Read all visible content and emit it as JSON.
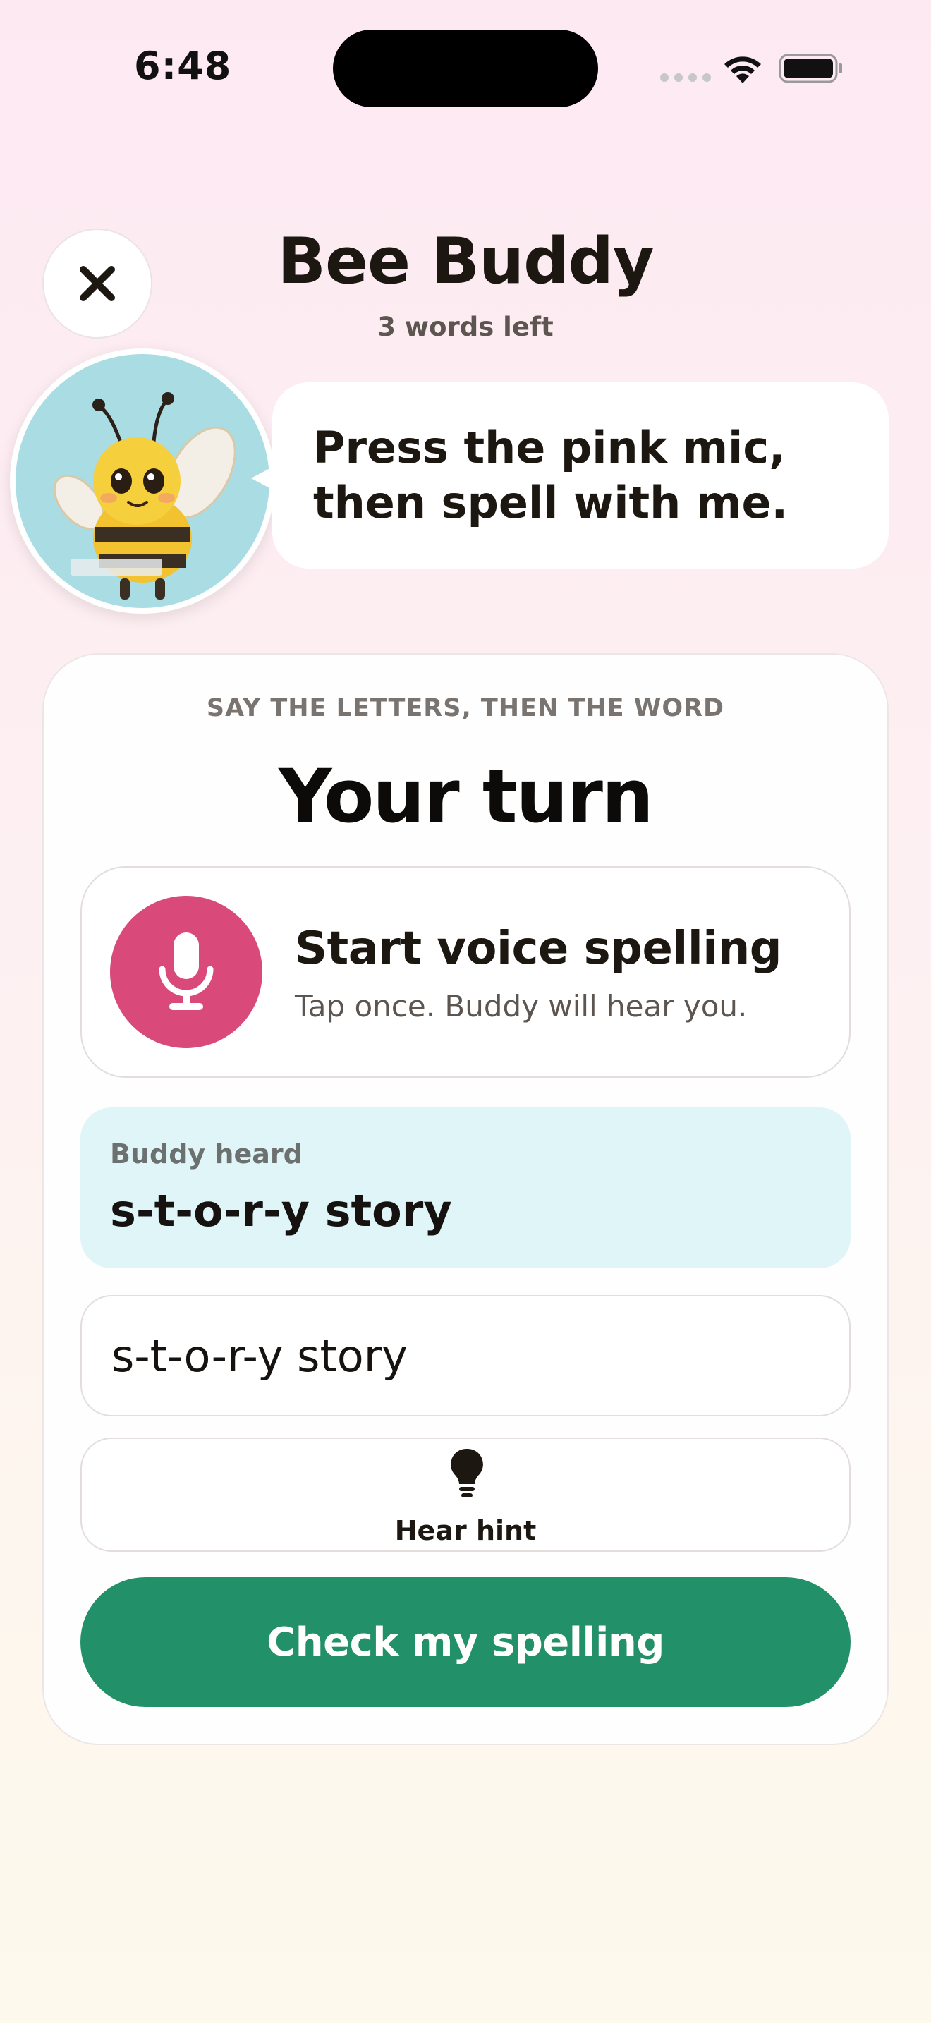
{
  "status_bar": {
    "time": "6:48"
  },
  "header": {
    "title": "Bee Buddy",
    "subtitle": "3 words left",
    "close_icon": "close-icon"
  },
  "buddy": {
    "avatar": "bee-mascot",
    "message": "Press the pink mic, then spell with me."
  },
  "card": {
    "instruction": "SAY THE LETTERS, THEN THE WORD",
    "heading": "Your turn",
    "voice": {
      "title": "Start voice spelling",
      "subtitle": "Tap once. Buddy will hear you.",
      "icon": "microphone-icon"
    },
    "heard": {
      "label": "Buddy heard",
      "value": "s-t-o-r-y story"
    },
    "input_value": "s-t-o-r-y story",
    "hint": {
      "label": "Hear hint",
      "icon": "lightbulb-icon"
    },
    "check_label": "Check my spelling"
  },
  "colors": {
    "mic": "#d9497a",
    "check": "#229068",
    "heard_bg": "#dff5f8",
    "avatar_bg": "#a9dce3"
  }
}
